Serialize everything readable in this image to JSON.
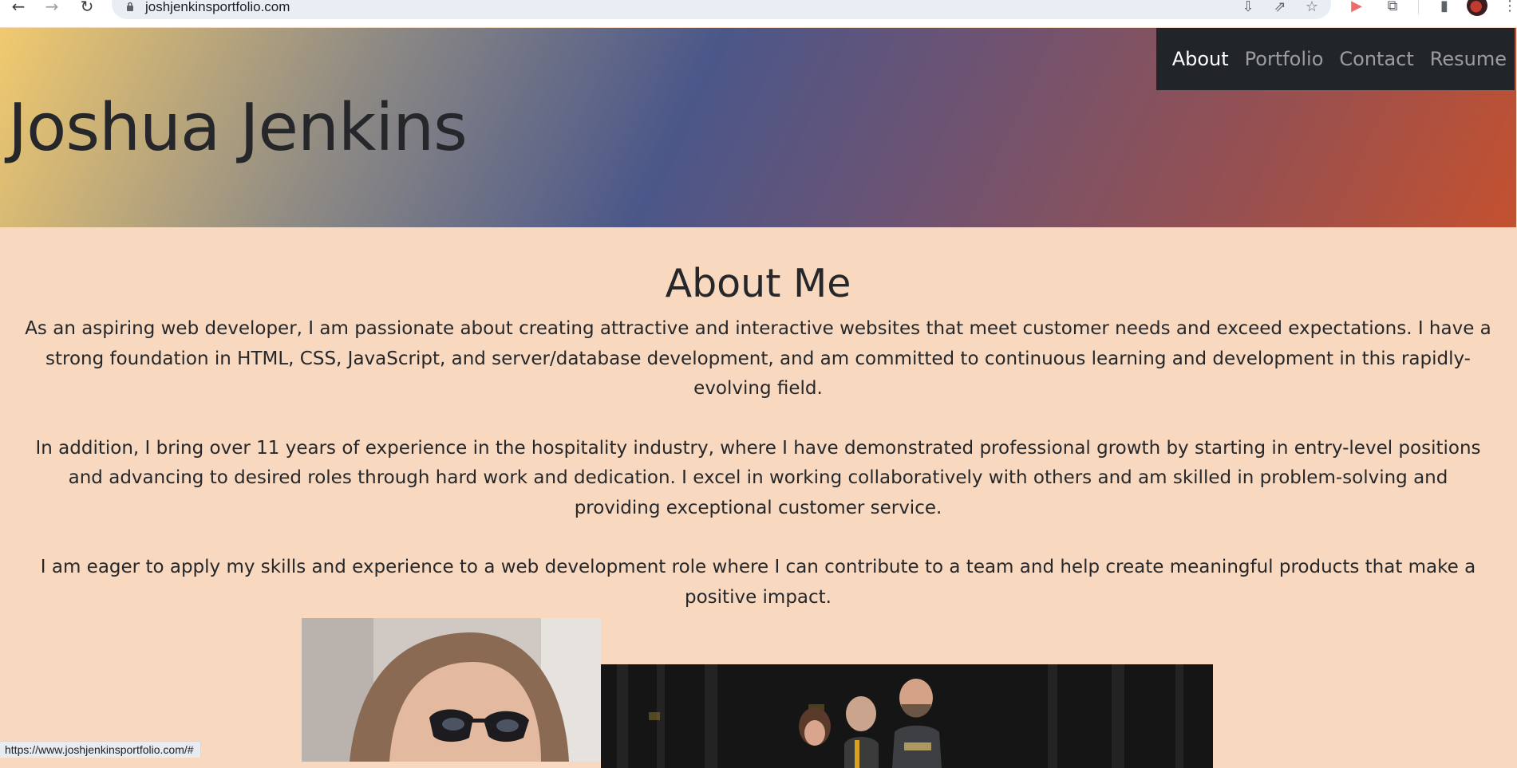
{
  "browser": {
    "url": "joshjenkinsportfolio.com",
    "status_url": "https://www.joshjenkinsportfolio.com/#"
  },
  "header": {
    "title": "Joshua Jenkins",
    "nav": [
      {
        "label": "About",
        "active": true
      },
      {
        "label": "Portfolio",
        "active": false
      },
      {
        "label": "Contact",
        "active": false
      },
      {
        "label": "Resume",
        "active": false
      }
    ]
  },
  "about": {
    "heading": "About Me",
    "paragraphs": [
      "As an aspiring web developer, I am passionate about creating attractive and interactive websites that meet customer needs and exceed expectations. I have a strong foundation in HTML, CSS, JavaScript, and server/database development, and am committed to continuous learning and development in this rapidly-evolving field.",
      "In addition, I bring over 11 years of experience in the hospitality industry, where I have demonstrated professional growth by starting in entry-level positions and advancing to desired roles through hard work and dedication. I excel in working collaboratively with others and am skilled in problem-solving and providing exceptional customer service.",
      "I am eager to apply my skills and experience to a web development role where I can contribute to a team and help create meaningful products that make a positive impact."
    ]
  },
  "colors": {
    "page_background": "#f8d9bf",
    "nav_background": "#212529",
    "text": "#25272b"
  },
  "icons": [
    "back-arrow-icon",
    "forward-arrow-icon",
    "reload-icon",
    "lock-icon",
    "install-icon",
    "share-icon",
    "star-icon",
    "extension-icon",
    "puzzle-icon",
    "side-panel-icon",
    "profile-avatar",
    "menu-icon"
  ]
}
